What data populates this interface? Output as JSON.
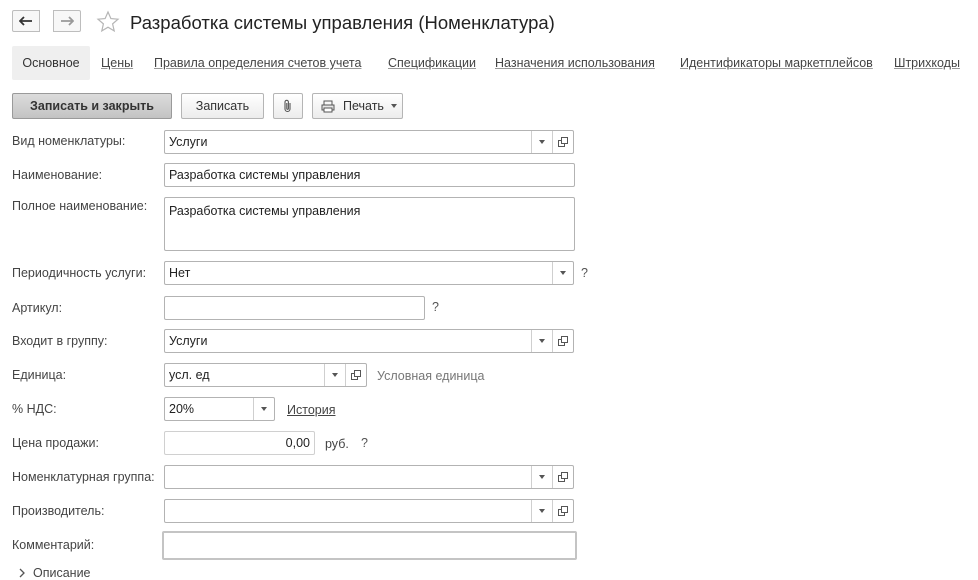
{
  "window": {
    "title": "Разработка системы управления (Номенклатура)"
  },
  "tabs": {
    "active": "Основное",
    "items": [
      "Цены",
      "Правила определения счетов учета",
      "Спецификации",
      "Назначения использования",
      "Идентификаторы маркетплейсов",
      "Штрихкоды"
    ]
  },
  "toolbar": {
    "save_close": "Записать и закрыть",
    "save": "Записать",
    "print": "Печать"
  },
  "form": {
    "kind_label": "Вид номенклатуры:",
    "kind_value": "Услуги",
    "name_label": "Наименование:",
    "name_value": "Разработка системы управления",
    "fullname_label": "Полное наименование:",
    "fullname_value": "Разработка системы управления",
    "period_label": "Периодичность услуги:",
    "period_value": "Нет",
    "article_label": "Артикул:",
    "article_value": "",
    "group_label": "Входит в группу:",
    "group_value": "Услуги",
    "unit_label": "Единица:",
    "unit_value": "усл. ед",
    "unit_hint": "Условная единица",
    "vat_label": "% НДС:",
    "vat_value": "20%",
    "vat_history": "История",
    "price_label": "Цена продажи:",
    "price_value": "0,00",
    "price_currency": "руб.",
    "nomgroup_label": "Номенклатурная группа:",
    "nomgroup_value": "",
    "maker_label": "Производитель:",
    "maker_value": "",
    "comment_label": "Комментарий:",
    "comment_value": "",
    "help_mark": "?",
    "description_label": "Описание"
  },
  "colors": {
    "primary_button": "#c8c8c8",
    "background": "#ffffff"
  }
}
